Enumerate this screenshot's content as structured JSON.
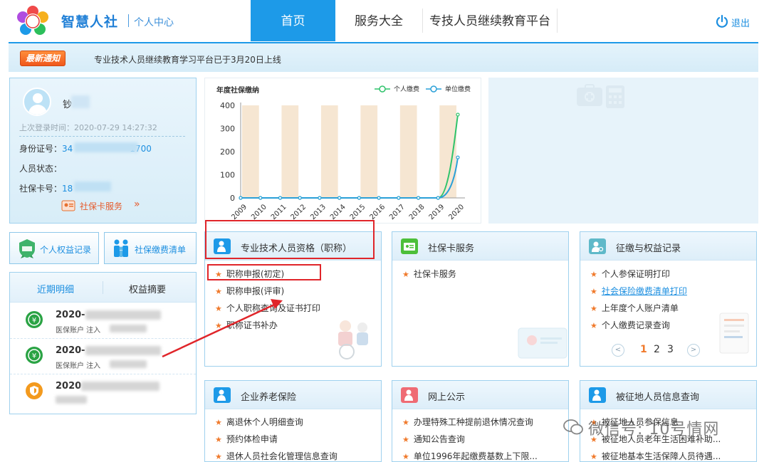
{
  "header": {
    "logo_text": "智慧人社",
    "logo_sub": "个人中心",
    "tabs": [
      {
        "label": "首页",
        "active": true
      },
      {
        "label": "服务大全",
        "active": false
      },
      {
        "label": "专技人员继续教育平台",
        "active": false
      }
    ],
    "logout_label": "退出",
    "accent_color": "#1d9ae8"
  },
  "notice": {
    "badge": "最新通知",
    "text": "专业技术人员继续教育学习平台已于3月20日上线"
  },
  "user": {
    "name_prefix": "钞",
    "last_login_label": "上次登录时间：",
    "last_login_value": "2020-07-29 14:27:32",
    "id_label": "身份证号：",
    "id_value_prefix": "34",
    "id_value_suffix": "1700",
    "status_label": "人员状态：",
    "card_label": "社保卡号：",
    "card_value_prefix": "18",
    "card_service": "社保卡服务"
  },
  "side_buttons": [
    {
      "label": "个人权益记录",
      "icon": "badge-icon"
    },
    {
      "label": "社保缴费清单",
      "icon": "family-icon"
    }
  ],
  "recent": {
    "tabs": [
      {
        "label": "近期明细",
        "active": true
      },
      {
        "label": "权益摘要",
        "active": false
      }
    ],
    "items": [
      {
        "date": "2020-",
        "desc": "医保账户 注入",
        "icon": "yuan-icon",
        "color": "#2aa344"
      },
      {
        "date": "2020-",
        "desc": "医保账户 注入",
        "icon": "yuan-icon",
        "color": "#2aa344"
      },
      {
        "date": "2020",
        "desc": "",
        "icon": "shield-icon",
        "color": "#f39a1e"
      }
    ]
  },
  "chart_data": {
    "type": "bar",
    "title": "年度社保缴纳",
    "categories": [
      "2009",
      "2010",
      "2011",
      "2012",
      "2013",
      "2014",
      "2015",
      "2016",
      "2017",
      "2018",
      "2019",
      "2020"
    ],
    "y_ticks": [
      0,
      100,
      200,
      300,
      400
    ],
    "ylim": [
      0,
      400
    ],
    "series": [
      {
        "name": "个人缴费",
        "type": "line",
        "color": "#2fc36b",
        "values": [
          0,
          0,
          0,
          0,
          0,
          0,
          0,
          0,
          0,
          0,
          0,
          360
        ]
      },
      {
        "name": "单位缴费",
        "type": "line",
        "color": "#2aa0d8",
        "values": [
          0,
          0,
          0,
          0,
          0,
          0,
          0,
          0,
          0,
          0,
          0,
          175
        ]
      }
    ],
    "band_color": "#f6e6d2",
    "legend_position": "top-right"
  },
  "services": [
    {
      "title": "专业技术人员资格（职称）",
      "icon": "person-icon",
      "icon_color": "#1d9ae8",
      "items": [
        {
          "label": "职称申报(初定)"
        },
        {
          "label": "职称申报(评审)"
        },
        {
          "label": "个人职称查询及证书打印"
        },
        {
          "label": "职称证书补办"
        }
      ]
    },
    {
      "title": "社保卡服务",
      "icon": "card-icon",
      "icon_color": "#4cbf3a",
      "items": [
        {
          "label": "社保卡服务"
        }
      ]
    },
    {
      "title": "征缴与权益记录",
      "icon": "person-search-icon",
      "icon_color": "#5fb9c9",
      "items": [
        {
          "label": "个人参保证明打印"
        },
        {
          "label": "社会保险缴费清单打印",
          "link": true
        },
        {
          "label": "上年度个人账户清单"
        },
        {
          "label": "个人缴费记录查询"
        }
      ],
      "pager": {
        "pages": [
          "1",
          "2",
          "3"
        ],
        "current": "1",
        "prev": "<",
        "next": ">"
      }
    },
    {
      "title": "企业养老保险",
      "icon": "person-icon",
      "icon_color": "#1d9ae8",
      "items": [
        {
          "label": "离退休个人明细查询"
        },
        {
          "label": "预约体检申请"
        },
        {
          "label": "退休人员社会化管理信息查询"
        }
      ]
    },
    {
      "title": "网上公示",
      "icon": "person-icon",
      "icon_color": "#ef6b74",
      "items": [
        {
          "label": "办理特殊工种提前退休情况查询"
        },
        {
          "label": "通知公告查询"
        },
        {
          "label": "单位1996年起缴费基数上下限..."
        }
      ]
    },
    {
      "title": "被征地人员信息查询",
      "icon": "person-icon",
      "icon_color": "#1d9ae8",
      "items": [
        {
          "label": "被征地人员参保信息"
        },
        {
          "label": "被征地人员老年生活困难补助..."
        },
        {
          "label": "被征地基本生活保障人员待遇..."
        }
      ]
    }
  ],
  "watermark": "微信号: 10号情网"
}
